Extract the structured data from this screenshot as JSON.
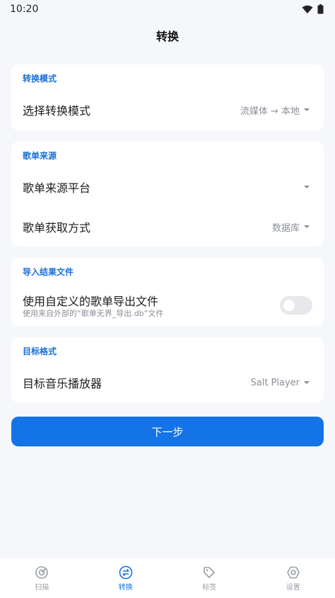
{
  "status": {
    "time": "10:20"
  },
  "header": {
    "title": "转换"
  },
  "sections": {
    "mode": {
      "header": "转换模式",
      "row_label": "选择转换模式",
      "row_value": "流媒体 → 本地"
    },
    "source": {
      "header": "歌单来源",
      "platform_label": "歌单来源平台",
      "platform_value": "",
      "method_label": "歌单获取方式",
      "method_value": "数据库"
    },
    "import": {
      "header": "导入结果文件",
      "toggle_label": "使用自定义的歌单导出文件",
      "toggle_desc": "使用来自外部的“歌单无界_导出.db”文件",
      "toggle_on": false
    },
    "target": {
      "header": "目标格式",
      "row_label": "目标音乐播放器",
      "row_value": "Salt Player"
    }
  },
  "next_button": "下一步",
  "bottom_nav": {
    "items": [
      {
        "label": "扫描",
        "icon": "scan-icon"
      },
      {
        "label": "转换",
        "icon": "convert-icon",
        "active": true
      },
      {
        "label": "标签",
        "icon": "tag-icon"
      },
      {
        "label": "设置",
        "icon": "settings-icon"
      }
    ]
  },
  "colors": {
    "accent": "#1473e6",
    "background": "#f5f7fb",
    "card": "#ffffff"
  }
}
